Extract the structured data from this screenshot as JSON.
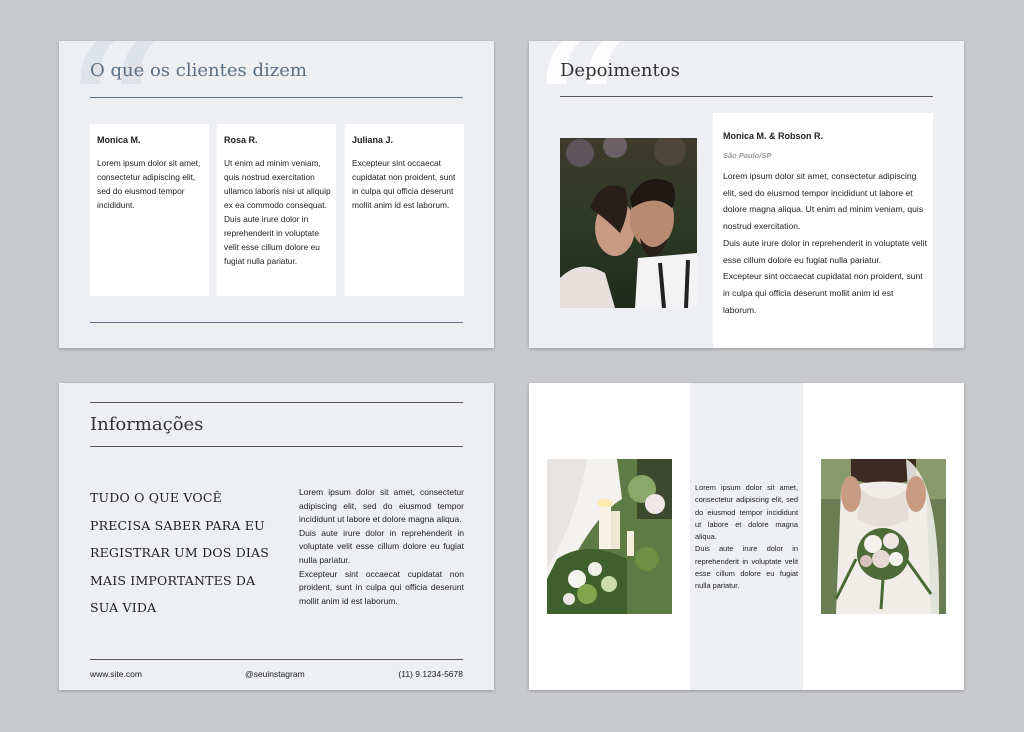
{
  "slide1": {
    "title": "O que os clientes dizem",
    "cards": [
      {
        "name": "Monica M.",
        "text": "Lorem ipsum dolor sit amet, consectetur adipiscing elit, sed do eiusmod tempor incididunt."
      },
      {
        "name": "Rosa R.",
        "text": "Ut enim ad minim veniam, quis nostrud exercitation ullamco laboris nisi ut aliquip ex ea commodo consequat. Duis aute irure dolor in reprehenderit in voluptate velit esse cillum dolore eu fugiat nulla pariatur."
      },
      {
        "name": "Juliana J.",
        "text": "Excepteur sint occaecat cupidatat non proident, sunt in culpa qui officia deserunt mollit anim id est laborum."
      }
    ]
  },
  "slide2": {
    "title": "Depoimentos",
    "name": "Monica M. & Robson R.",
    "location": "São Paulo/SP",
    "paragraphs": [
      "Lorem ipsum dolor sit amet, consectetur adipiscing elit, sed do eiusmod tempor incididunt ut labore et dolore magna aliqua. Ut enim ad minim veniam, quis nostrud exercitation.",
      "Duis aute irure dolor in reprehenderit in voluptate velit esse cillum dolore eu fugiat nulla pariatur.",
      "Excepteur sint occaecat cupidatat non proident, sunt in culpa qui officia deserunt mollit anim id est laborum."
    ]
  },
  "slide3": {
    "title": "Informações",
    "heading_lines": [
      "TUDO O QUE VOCÊ",
      "PRECISA SABER PARA EU",
      "REGISTRAR UM DOS DIAS",
      "MAIS IMPORTANTES DA",
      "SUA VIDA"
    ],
    "paragraphs": [
      "Lorem ipsum dolor sit amet, consectetur adipiscing elit, sed do eiusmod tempor incididunt ut labore et dolore magna aliqua.",
      "Duis aute irure dolor in reprehenderit in voluptate velit esse cillum dolore eu fugiat nulla pariatur.",
      "Excepteur sint occaecat cupidatat non proident, sunt in culpa qui officia deserunt mollit anim id est laborum."
    ],
    "footer": {
      "site": "www.site.com",
      "instagram": "@seuinstagram",
      "phone": "(11) 9.1234-5678"
    }
  },
  "slide4": {
    "paragraphs": [
      "Lorem ipsum dolor sit amet, consectetur adipiscing elit, sed do eiusmod tempor incididunt ut labore et dolore magna aliqua.",
      "Duis aute irure dolor in reprehenderit in voluptate velit esse cillum dolore eu fugiat nulla pariatur."
    ]
  },
  "colors": {
    "background": "#c8cacd",
    "slide": "#edeff3",
    "accent_blue": "#5d6f85",
    "rule": "#555555"
  }
}
